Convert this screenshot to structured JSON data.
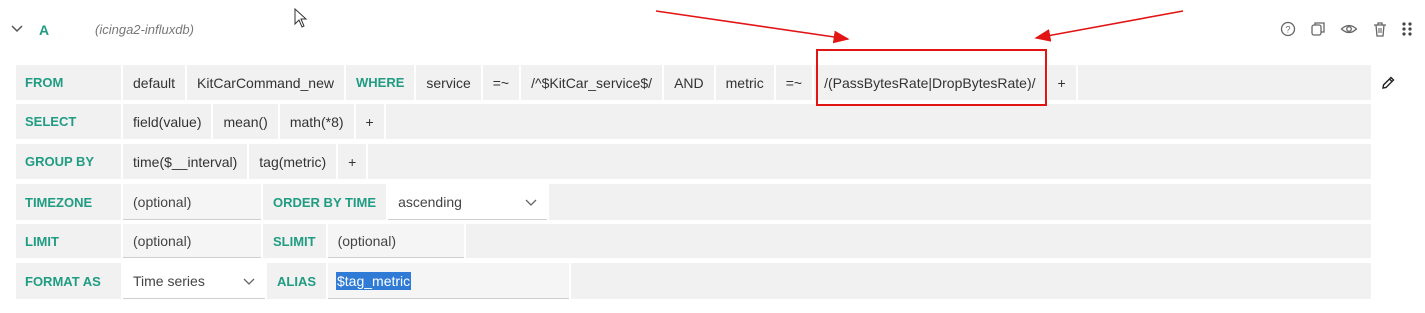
{
  "header": {
    "query_letter": "A",
    "datasource": "(icinga2-influxdb)",
    "icons": [
      "chevron-down-icon",
      "help-icon",
      "copy-icon",
      "eye-icon",
      "trash-icon",
      "drag-handle-icon"
    ]
  },
  "from_row": {
    "label": "FROM",
    "items": [
      "default",
      "KitCarCommand_new"
    ],
    "where_label": "WHERE",
    "where": [
      "service",
      "=~",
      "/^$KitCar_service$/",
      "AND",
      "metric",
      "=~",
      "/(PassBytesRate|DropBytesRate)/"
    ],
    "add": "+"
  },
  "select_row": {
    "label": "SELECT",
    "items": [
      "field(value)",
      "mean()",
      "math(*8)"
    ],
    "add": "+"
  },
  "group_row": {
    "label": "GROUP BY",
    "items": [
      "time($__interval)",
      "tag(metric)"
    ],
    "add": "+"
  },
  "timezone_row": {
    "label": "TIMEZONE",
    "timezone_placeholder": "(optional)",
    "order_label": "ORDER BY TIME",
    "order_value": "ascending"
  },
  "limit_row": {
    "label": "LIMIT",
    "limit_placeholder": "(optional)",
    "slimit_label": "SLIMIT",
    "slimit_placeholder": "(optional)"
  },
  "format_row": {
    "label": "FORMAT AS",
    "format_value": "Time series",
    "alias_label": "ALIAS",
    "alias_value": "$tag_metric"
  },
  "colors": {
    "keyword": "#1f9c82",
    "annotation": "#e21414",
    "selection": "#2f7bd6"
  }
}
